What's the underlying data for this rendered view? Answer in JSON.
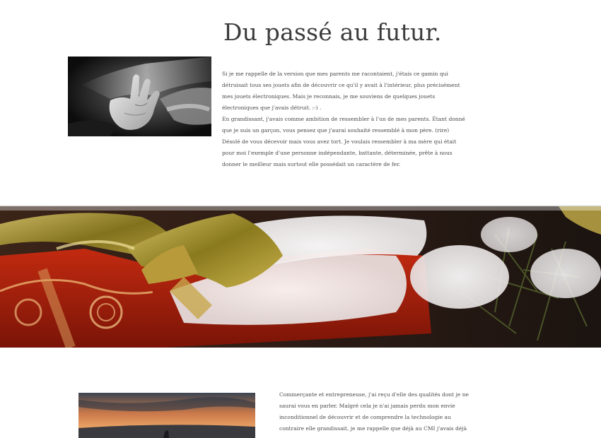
{
  "page": {
    "title": "Du passé au futur."
  },
  "story_intro": {
    "lines": [
      "Si je me rappelle de la version que mes parents me racontaient, j'étais ce gamin qui",
      "détruisait tous ses jouets afin de découvrir ce qu'il y avait à l'intérieur, plus précisément",
      "mes jouets électroniques. Mais je reconnais, je me souviens de quelques jouets",
      "électroniques que j'avais détruit. :-) .",
      "En grandissant, j'avais comme ambition de ressembler à l'un de mes parents. Étant donné",
      "que je suis un garçon, vous pensez que j'aurai souhaité ressemblé à mon père. (rire)",
      "Désolé de vous décevoir mais vous avez tort. Je voulais ressembler à ma mère qui était",
      "pour moi l'exemple d'une personne indépendante, battante, déterminée, prête à nous",
      "donner le meilleur mais surtout elle possédait un caractère de fer."
    ]
  },
  "story_mother": {
    "lines": [
      "Commerçante et entrepreneuse, j'ai reçu d'elle des qualités dont je ne",
      "saurai vous en parler. Malgré cela je n'ai jamais perdu mon envie",
      "inconditionnel de découvrir et de comprendre la technologie au",
      "contraire elle grandissait, je me rappelle que déjà au CMI j'avais déjà"
    ]
  },
  "images": {
    "hands": "photo-hands-bw",
    "banner": "christmas-gift-banner",
    "sunset": "sunset-silhouette-photo"
  }
}
